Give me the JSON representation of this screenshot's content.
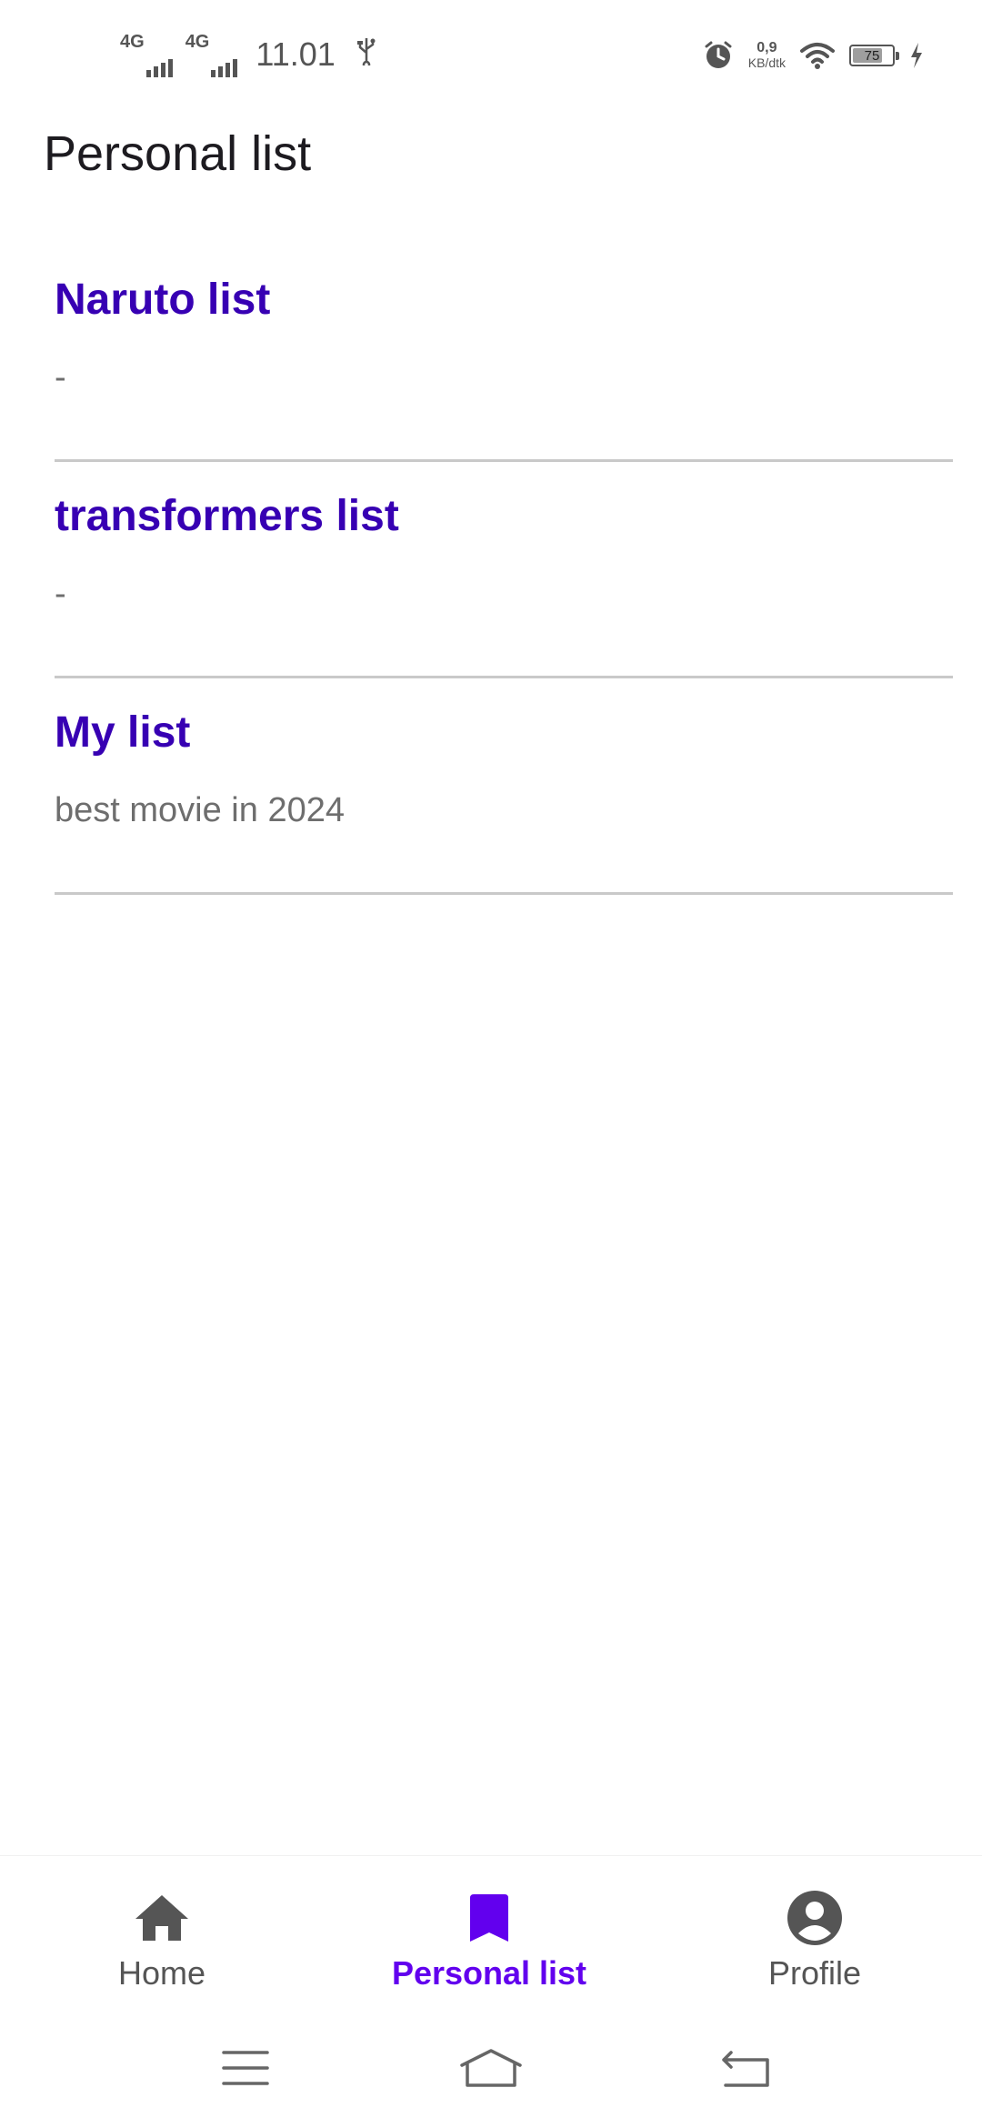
{
  "status_bar": {
    "network_1": "4G",
    "network_2": "4G",
    "time": "11.01",
    "speed_value": "0,9",
    "speed_unit": "KB/dtk",
    "battery_level": "75",
    "battery_fraction": 0.75
  },
  "top_bar": {
    "title": "Personal list"
  },
  "lists": [
    {
      "title": "Naruto list",
      "description": "-"
    },
    {
      "title": "transformers list",
      "description": "-"
    },
    {
      "title": "My list",
      "description": "best movie in 2024"
    }
  ],
  "bottom_nav": {
    "items": [
      {
        "label": "Home",
        "icon": "home-icon",
        "active": false
      },
      {
        "label": "Personal list",
        "icon": "bookmark-icon",
        "active": true
      },
      {
        "label": "Profile",
        "icon": "account-circle-icon",
        "active": false
      }
    ]
  },
  "system_nav": {
    "icons": [
      "menu-icon",
      "home-outline-icon",
      "back-icon"
    ]
  },
  "colors": {
    "list_title": "#3700b3",
    "active_nav": "#6200ee",
    "inactive_nav": "#555555",
    "divider": "#c9c9c9"
  }
}
